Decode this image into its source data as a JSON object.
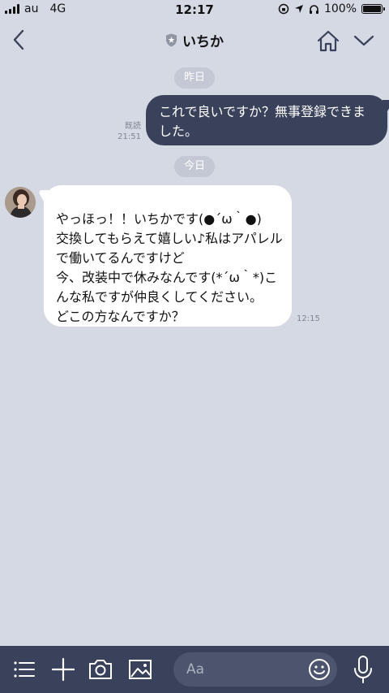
{
  "status_bar": {
    "carrier": "au",
    "network": "4G",
    "time": "12:17",
    "battery": "100%"
  },
  "header": {
    "title": "いちか",
    "icons": [
      "back-arrow-icon",
      "shield-icon",
      "home-icon",
      "chevron-down-icon"
    ]
  },
  "chat": {
    "date_yesterday": "昨日",
    "date_today": "今日",
    "outgoing": {
      "text": "これで良いですか？無事登録できました。",
      "read_label": "既読",
      "time": "21:51"
    },
    "incoming": {
      "text": "やっほっ！！いちかです(●´ω｀●)\n交換してもらえて嬉しい♪私はアパレルで働いてるんですけど\n今、改装中で休みなんです(*´ω｀*)こんな私ですが仲良くしてください。\nどこの方なんですか？",
      "time": "12:15"
    }
  },
  "toolbar": {
    "placeholder": "Aa",
    "icons": [
      "menu-icon",
      "plus-icon",
      "camera-icon",
      "image-icon",
      "emoji-icon",
      "microphone-icon"
    ],
    "accent": "#39425a"
  }
}
